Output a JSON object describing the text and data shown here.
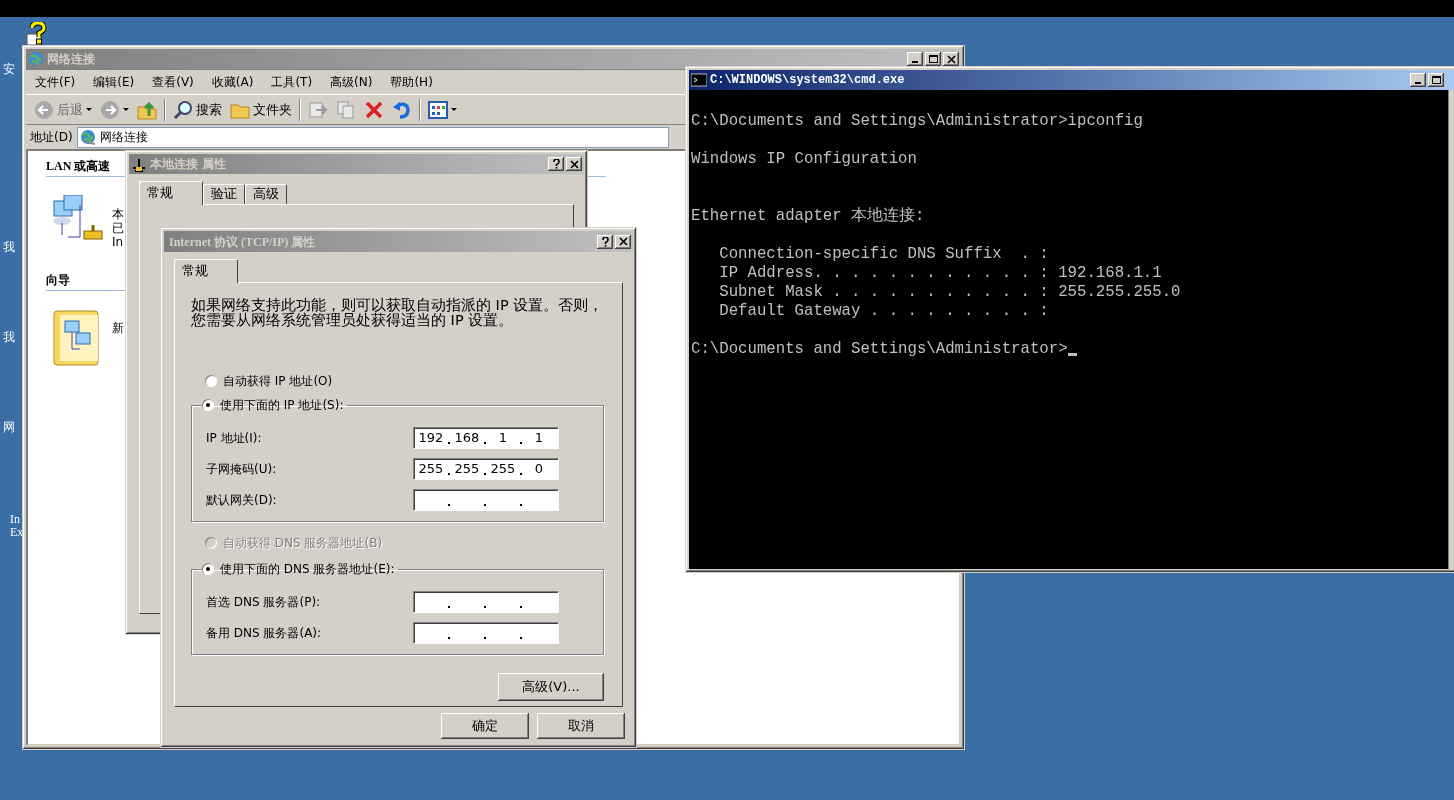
{
  "desktop": {
    "icon_labels": [
      {
        "text": "安"
      },
      {
        "text": "我"
      },
      {
        "text": "我"
      },
      {
        "text": "网"
      },
      {
        "text": "In"
      },
      {
        "text": "Ex"
      }
    ]
  },
  "explorer": {
    "title": "网络连接",
    "menu": [
      "文件(F)",
      "编辑(E)",
      "查看(V)",
      "收藏(A)",
      "工具(T)",
      "高级(N)",
      "帮助(H)"
    ],
    "toolbar": [
      {
        "kind": "back",
        "label": "后退",
        "disabled": true
      },
      {
        "kind": "forward",
        "disabled": true
      },
      {
        "kind": "up",
        "disabled": false
      },
      {
        "kind": "sep"
      },
      {
        "kind": "search",
        "label": "搜索",
        "disabled": false
      },
      {
        "kind": "folders",
        "label": "文件夹",
        "disabled": false
      },
      {
        "kind": "sep"
      },
      {
        "kind": "move",
        "disabled": true
      },
      {
        "kind": "copy",
        "disabled": true
      },
      {
        "kind": "delete",
        "disabled": false
      },
      {
        "kind": "undo",
        "disabled": false
      },
      {
        "kind": "sep"
      },
      {
        "kind": "views",
        "disabled": false
      }
    ],
    "address": {
      "label": "地址(D)",
      "value": "网络连接"
    },
    "sections": [
      {
        "heading": "LAN 或高速",
        "items": [
          {
            "kind": "network",
            "lines": [
              "本",
              "已",
              "In"
            ]
          }
        ]
      },
      {
        "heading": "向导",
        "items": [
          {
            "kind": "wizard",
            "lines": [
              "新"
            ]
          }
        ]
      }
    ]
  },
  "connection_properties": {
    "title": "本地连接 属性",
    "tabs": [
      {
        "label": "常规",
        "selected": true
      },
      {
        "label": "验证",
        "selected": false
      },
      {
        "label": "高级",
        "selected": false
      }
    ]
  },
  "tcpip_properties": {
    "title": "Internet 协议 (TCP/IP) 属性",
    "tabs": [
      {
        "label": "常规",
        "selected": true
      }
    ],
    "description": "如果网络支持此功能，则可以获取自动指派的 IP 设置。否则，您需要从网络系统管理员处获得适当的 IP 设置。",
    "ip_auto": {
      "label": "自动获得 IP 地址(O)",
      "selected": false,
      "disabled": false
    },
    "ip_manual": {
      "label": "使用下面的 IP 地址(S):",
      "selected": true,
      "disabled": false,
      "fields": [
        {
          "label": "IP 地址(I):",
          "octets": [
            "192",
            "168",
            "1",
            "1"
          ]
        },
        {
          "label": "子网掩码(U):",
          "octets": [
            "255",
            "255",
            "255",
            "0"
          ]
        },
        {
          "label": "默认网关(D):"
        }
      ]
    },
    "dns_auto": {
      "label": "自动获得 DNS 服务器地址(B)",
      "selected": false,
      "disabled": true
    },
    "dns_manual": {
      "label": "使用下面的 DNS 服务器地址(E):",
      "selected": true,
      "disabled": false,
      "fields": [
        {
          "label": "首选 DNS 服务器(P):"
        },
        {
          "label": "备用 DNS 服务器(A):"
        }
      ]
    },
    "advanced_button": "高级(V)...",
    "buttons": [
      "确定",
      "取消"
    ]
  },
  "console": {
    "title": "C:\\WINDOWS\\system32\\cmd.exe",
    "lines": [
      {
        "kind": "blank"
      },
      {
        "kind": "text",
        "text": "C:\\Documents and Settings\\Administrator>ipconfig"
      },
      {
        "kind": "blank"
      },
      {
        "kind": "text",
        "text": "Windows IP Configuration"
      },
      {
        "kind": "blank"
      },
      {
        "kind": "blank"
      },
      {
        "kind": "text",
        "text": "Ethernet adapter 本地连接:"
      },
      {
        "kind": "blank"
      },
      {
        "kind": "text",
        "text": "   Connection-specific DNS Suffix  . :"
      },
      {
        "kind": "text",
        "text": "   IP Address. . . . . . . . . . . . : 192.168.1.1"
      },
      {
        "kind": "text",
        "text": "   Subnet Mask . . . . . . . . . . . : 255.255.255.0"
      },
      {
        "kind": "text",
        "text": "   Default Gateway . . . . . . . . . :"
      },
      {
        "kind": "blank"
      },
      {
        "kind": "prompt",
        "text": "C:\\Documents and Settings\\Administrator>",
        "cursor": true
      }
    ]
  }
}
